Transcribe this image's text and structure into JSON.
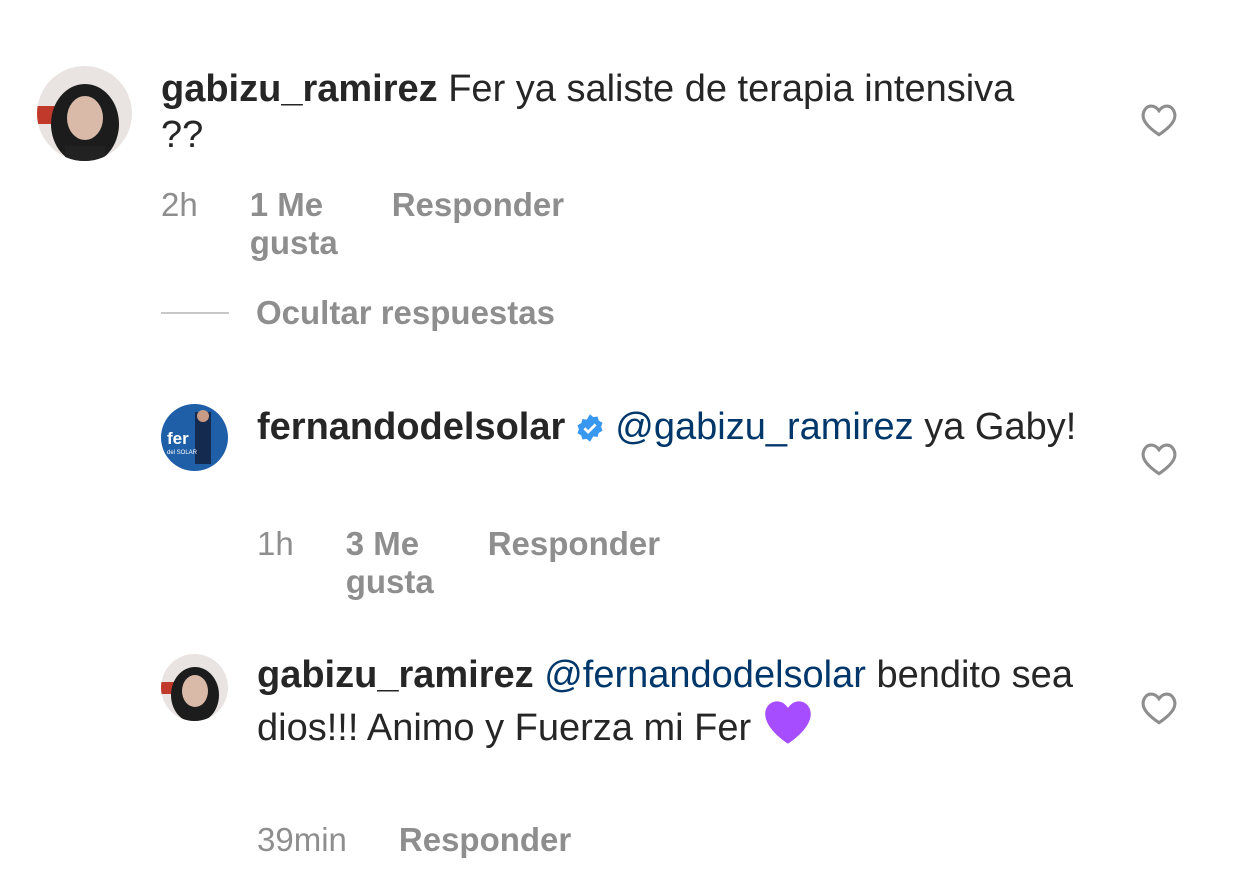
{
  "comments": [
    {
      "username": "gabizu_ramirez",
      "verified": false,
      "mention": "",
      "text": "Fer ya saliste de terapia intensiva ??",
      "time": "2h",
      "likes": "1 Me gusta",
      "reply": "Responder"
    },
    {
      "username": "fernandodelsolar",
      "verified": true,
      "mention": "@gabizu_ramirez",
      "text": "ya Gaby!",
      "time": "1h",
      "likes": "3 Me gusta",
      "reply": "Responder",
      "avatar_text": "fer",
      "avatar_subtext": "del SOLAR"
    },
    {
      "username": "gabizu_ramirez",
      "verified": false,
      "mention": "@fernandodelsolar",
      "text": "bendito sea dios!!! Animo y Fuerza mi Fer",
      "emoji": "purple-heart",
      "time": "39min",
      "likes": "",
      "reply": "Responder"
    }
  ],
  "hide_replies_label": "Ocultar respuestas",
  "colors": {
    "text": "#262626",
    "meta": "#8e8e8e",
    "mention": "#00376b",
    "verified": "#3897f0",
    "emoji": "#a64dff"
  }
}
